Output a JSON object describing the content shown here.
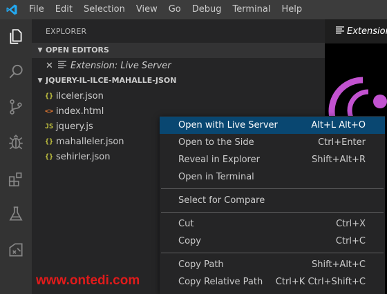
{
  "menubar": {
    "items": [
      "File",
      "Edit",
      "Selection",
      "View",
      "Go",
      "Debug",
      "Terminal",
      "Help"
    ]
  },
  "activitybar": {
    "icons": [
      "files-icon",
      "search-icon",
      "source-control-icon",
      "debug-icon",
      "extensions-icon",
      "flask-icon",
      "remote-icon"
    ]
  },
  "sidebar": {
    "title": "EXPLORER",
    "open_editors": {
      "header": "OPEN EDITORS",
      "items": [
        {
          "label": "Extension: Live Server"
        }
      ]
    },
    "folder": {
      "header": "JQUERY-IL-ILCE-MAHALLE-JSON",
      "files": [
        {
          "icon": "{}",
          "name": "ilceler.json",
          "color": "#cbcb41"
        },
        {
          "icon": "<>",
          "name": "index.html",
          "color": "#e37933"
        },
        {
          "icon": "JS",
          "name": "jquery.js",
          "color": "#cbcb41"
        },
        {
          "icon": "{}",
          "name": "mahalleler.json",
          "color": "#cbcb41"
        },
        {
          "icon": "{}",
          "name": "sehirler.json",
          "color": "#cbcb41"
        }
      ]
    }
  },
  "editor": {
    "tab_label": "Extension: Live Server"
  },
  "context_menu": {
    "items": [
      {
        "label": "Open with Live Server",
        "shortcut": "Alt+L Alt+O"
      },
      {
        "label": "Open to the Side",
        "shortcut": "Ctrl+Enter"
      },
      {
        "label": "Reveal in Explorer",
        "shortcut": "Shift+Alt+R"
      },
      {
        "label": "Open in Terminal",
        "shortcut": ""
      },
      {
        "label": "Select for Compare",
        "shortcut": ""
      },
      {
        "label": "Cut",
        "shortcut": "Ctrl+X"
      },
      {
        "label": "Copy",
        "shortcut": "Ctrl+C"
      },
      {
        "label": "Copy Path",
        "shortcut": "Shift+Alt+C"
      },
      {
        "label": "Copy Relative Path",
        "shortcut": "Ctrl+K Ctrl+Shift+C"
      }
    ]
  },
  "watermark": "www.ontedi.com",
  "colors": {
    "accent_blue": "#007acc",
    "menu_highlight": "#094771",
    "live_server_purple": "#c252d0",
    "watermark_red": "#e01b1b"
  }
}
